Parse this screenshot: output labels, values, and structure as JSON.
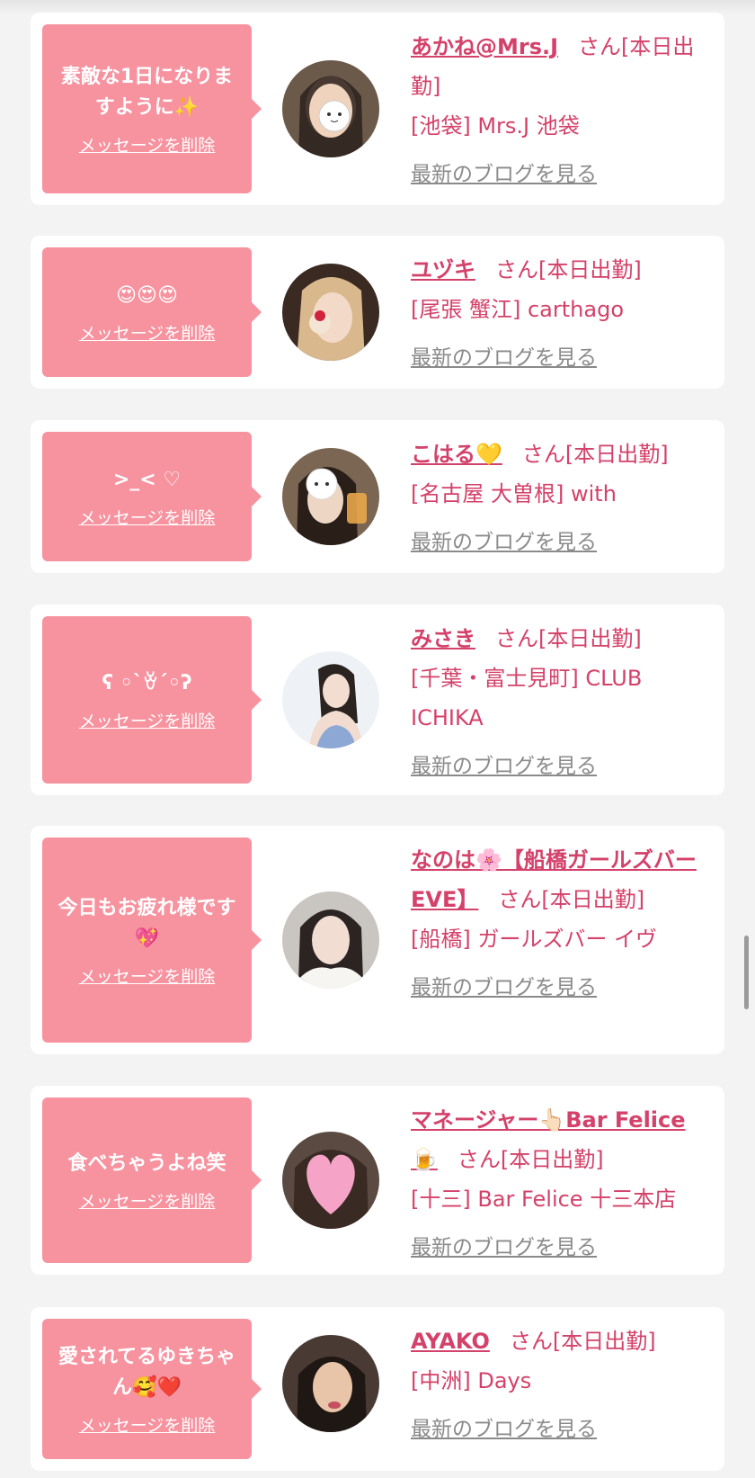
{
  "delete_label": "メッセージを削除",
  "san_suffix": "さん[本日出勤]",
  "blog_label": "最新のブログを見る",
  "colors": {
    "bubble": "#f7929f",
    "name": "#d4416a",
    "link_gray": "#8a8a8a",
    "background": "#f3f3f3"
  },
  "messages": [
    {
      "text": "素敵な1日になりますように✨",
      "name": "あかね@Mrs.J",
      "shop": "[池袋] Mrs.J 池袋"
    },
    {
      "text": "😍😍😍",
      "name": "ユヅキ",
      "shop": "[尾張 蟹江] carthago"
    },
    {
      "text": ">_< ♡",
      "name": "こはる💛",
      "shop": "[名古屋 大曽根] with"
    },
    {
      "text": "ʕ ◦`ꈊ´◦ʔ",
      "name": "みさき",
      "shop": "[千葉・富士見町] CLUB ICHIKA"
    },
    {
      "text": "今日もお疲れ様です💖",
      "name": "なのは🌸【船橋ガールズバーEVE】",
      "shop": "[船橋] ガールズバー イヴ"
    },
    {
      "text": "食べちゃうよね笑",
      "name": "マネージャー👆🏻Bar Felice🍺",
      "shop": "[十三] Bar Felice 十三本店"
    },
    {
      "text": "愛されてるゆきちゃん🥰❤️",
      "name": "AYAKO",
      "shop": "[中洲] Days"
    }
  ]
}
